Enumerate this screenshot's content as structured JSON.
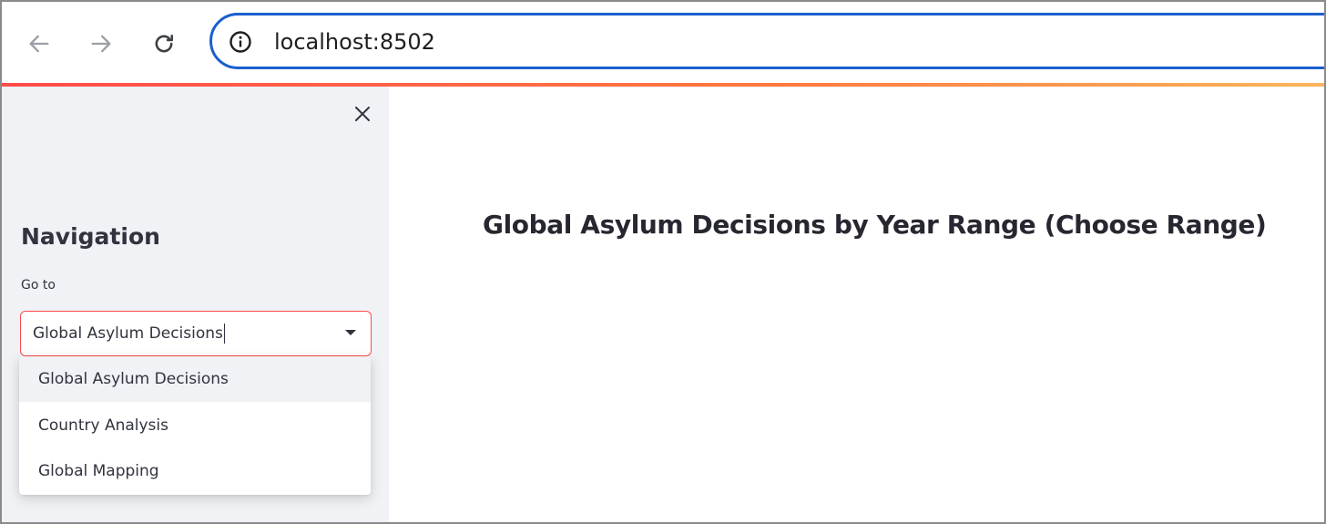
{
  "browser": {
    "url": "localhost:8502",
    "accent_color": "#1b5fce"
  },
  "sidebar": {
    "title": "Navigation",
    "select_label": "Go to",
    "selected_value": "Global Asylum Decisions",
    "options": [
      "Global Asylum Decisions",
      "Country Analysis",
      "Global Mapping"
    ]
  },
  "main": {
    "title": "Global Asylum Decisions by Year Range (Choose Range)"
  },
  "colors": {
    "streamlit_primary": "#ff4b4b",
    "sidebar_bg": "#f0f2f6",
    "text": "#31333f"
  }
}
